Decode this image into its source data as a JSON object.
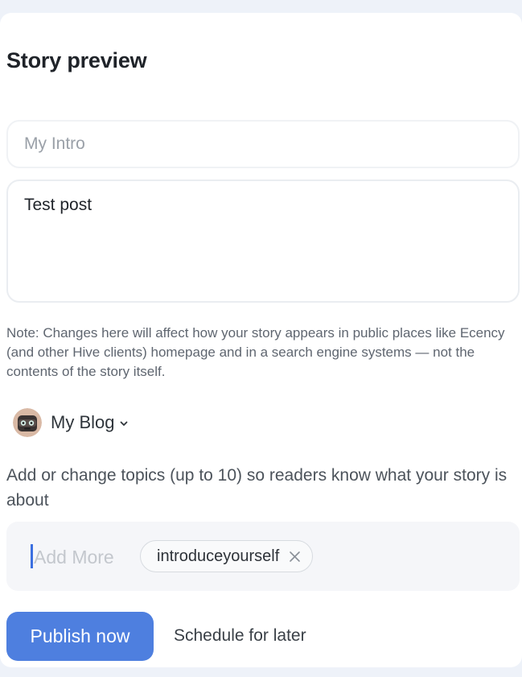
{
  "header": {
    "title": "Story preview"
  },
  "form": {
    "intro_placeholder": "My Intro",
    "description_value": "Test post",
    "note": "Note: Changes here will affect how your story appears in public places like Ecency (and other Hive clients) homepage and in a search engine systems — not the contents of the story itself."
  },
  "community": {
    "label": "My Blog",
    "dropdown_icon": "chevron-down-icon"
  },
  "topics": {
    "help_text": "Add or change topics (up to 10) so readers know what your story is about",
    "input_placeholder": "Add More",
    "tags": [
      {
        "label": "introduceyourself",
        "remove_icon": "close-icon"
      }
    ]
  },
  "actions": {
    "publish_label": "Publish now",
    "schedule_label": "Schedule for later"
  },
  "colors": {
    "accent": "#4e7fdf",
    "page_background": "#eef2f9",
    "card_background": "#ffffff",
    "tags_background": "#f5f6f9"
  }
}
